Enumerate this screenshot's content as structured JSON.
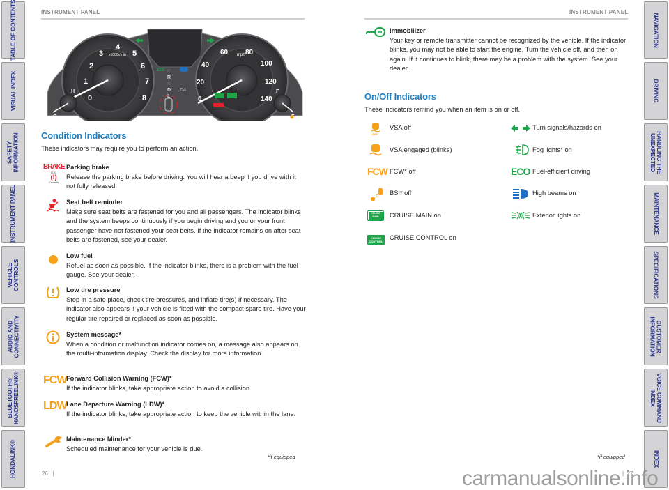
{
  "left_tabs": [
    {
      "label": "TABLE OF CONTENTS"
    },
    {
      "label": "VISUAL INDEX"
    },
    {
      "label": "SAFETY\nINFORMATION"
    },
    {
      "label": "INSTRUMENT PANEL"
    },
    {
      "label": "VEHICLE\nCONTROLS"
    },
    {
      "label": "AUDIO AND\nCONNECTIVITY"
    },
    {
      "label": "BLUETOOTH®\nHANDSFREELINK®"
    },
    {
      "label": "HONDALINK®"
    }
  ],
  "right_tabs": [
    {
      "label": "NAVIGATION"
    },
    {
      "label": "DRIVING"
    },
    {
      "label": "HANDLING THE\nUNEXPECTED"
    },
    {
      "label": "MAINTENANCE"
    },
    {
      "label": "SPECIFICATIONS"
    },
    {
      "label": "CUSTOMER\nINFORMATION"
    },
    {
      "label": "VOICE COMMAND\nINDEX"
    },
    {
      "label": "INDEX"
    }
  ],
  "left_page": {
    "header": "INSTRUMENT PANEL",
    "page_number": "26",
    "cluster": {
      "tach_labels": [
        "0",
        "1",
        "2",
        "3",
        "4",
        "5",
        "6",
        "7",
        "8"
      ],
      "tach_unit": "x1000r/min",
      "speed_labels": [
        "0",
        "20",
        "40",
        "60",
        "80",
        "100",
        "120",
        "140"
      ],
      "speed_unit": "mph",
      "gear_labels": [
        "P",
        "R",
        "N",
        "D",
        "L"
      ],
      "d4_label": "D4",
      "eco_label": "ECO",
      "temp_labels": [
        "H",
        "C"
      ],
      "fuel_labels": [
        "F",
        "E"
      ]
    },
    "section_title": "Condition Indicators",
    "section_intro": "These indicators may require you to perform an action.",
    "brake_icon": {
      "text": "BRAKE",
      "us": "U.S.",
      "canada": "Canada"
    },
    "items": [
      {
        "icon": "brake-icon",
        "title": "Parking brake",
        "text": "Release the parking brake before driving. You will hear a beep if you drive with it not fully released."
      },
      {
        "icon": "seat-belt-icon",
        "title": "Seat belt reminder",
        "text": "Make sure seat belts are fastened for you and all passengers. The indicator blinks and the system beeps continuously if you begin driving and you or your front passenger have not fastened your seat belts. If the indicator remains on after seat belts are fastened, see your dealer."
      },
      {
        "icon": "low-fuel-icon",
        "title": "Low fuel",
        "text": "Refuel as soon as possible. If the indicator blinks, there is a problem with the fuel gauge. See your dealer."
      },
      {
        "icon": "tire-pressure-icon",
        "title": "Low tire pressure",
        "text": "Stop in a safe place, check tire pressures, and inflate tire(s) if necessary. The indicator also appears if your vehicle is fitted with the compact spare tire. Have your regular tire repaired or replaced as soon as possible."
      },
      {
        "icon": "system-message-icon",
        "title": "System message*",
        "text": "When a condition or malfunction indicator comes on, a message also appears on the multi-information display. Check the display for more information."
      },
      {
        "icon": "fcw-icon",
        "icon_text": "FCW",
        "title": "Forward Collision Warning (FCW)*",
        "text": "If the indicator blinks, take appropriate action to avoid a collision."
      },
      {
        "icon": "ldw-icon",
        "icon_text": "LDW",
        "title": "Lane Departure Warning (LDW)*",
        "text": "If the indicator blinks, take appropriate action to keep the vehicle within the lane."
      },
      {
        "icon": "wrench-icon",
        "title": "Maintenance Minder*",
        "text": "Scheduled maintenance for your vehicle is due."
      }
    ],
    "footnote": "*if equipped"
  },
  "right_page": {
    "header": "INSTRUMENT PANEL",
    "page_number": "27",
    "immobilizer": {
      "title": "Immobilizer",
      "text": "Your key or remote transmitter cannot be recognized by the vehicle. If the indicator blinks, you may not be able to start the engine. Turn the vehicle off, and then on again. If it continues to blink, there may be a problem with the system. See your dealer."
    },
    "section_title": "On/Off Indicators",
    "section_intro": "These indicators remind you when an item is on or off.",
    "left_column": [
      {
        "icon": "vsa-off-icon",
        "label": "VSA off"
      },
      {
        "icon": "vsa-engaged-icon",
        "label": "VSA engaged (blinks)"
      },
      {
        "icon": "fcw-off-icon",
        "icon_text": "FCW",
        "label": "FCW* off"
      },
      {
        "icon": "bsi-off-icon",
        "label": "BSI* off"
      },
      {
        "icon": "cruise-main-icon",
        "icon_text": "CRUISE MAIN",
        "label": "CRUISE MAIN on"
      },
      {
        "icon": "cruise-control-icon",
        "icon_text": "CRUISE CONTROL",
        "label": "CRUISE CONTROL on"
      }
    ],
    "right_column": [
      {
        "icon": "turn-signal-icon",
        "label": "Turn signals/hazards on"
      },
      {
        "icon": "fog-light-icon",
        "label": "Fog lights* on"
      },
      {
        "icon": "eco-icon",
        "icon_text": "ECO",
        "label": "Fuel-efficient driving"
      },
      {
        "icon": "high-beam-icon",
        "label": "High beams on"
      },
      {
        "icon": "exterior-lights-icon",
        "label": "Exterior lights on"
      }
    ],
    "footnote": "*if equipped"
  },
  "watermark": "carmanualsonline.info",
  "colors": {
    "accent": "#1e80c3",
    "tab_text": "#2b3590",
    "amber": "#f7a11a",
    "green": "#1ea54a",
    "red": "#e5202e",
    "blue": "#1d6fc2"
  }
}
